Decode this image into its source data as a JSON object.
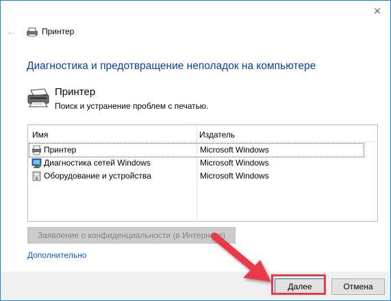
{
  "window": {
    "title": "Принтер",
    "close_glyph": "✕",
    "back_glyph": "←"
  },
  "main": {
    "heading": "Диагностика и предотвращение неполадок на компьютере",
    "program_name": "Принтер",
    "program_description": "Поиск и устранение проблем с печатью."
  },
  "table": {
    "columns": [
      "Имя",
      "Издатель"
    ],
    "rows": [
      {
        "name": "Принтер",
        "publisher": "Microsoft Windows",
        "icon": "printer-icon"
      },
      {
        "name": "Диагностика сетей Windows",
        "publisher": "Microsoft Windows",
        "icon": "network-icon"
      },
      {
        "name": "Оборудование и устройства",
        "publisher": "Microsoft Windows",
        "icon": "device-icon"
      }
    ]
  },
  "buttons": {
    "privacy": "Заявление о конфиденциальности (в Интернете)",
    "advanced": "Дополнительно",
    "next": "Далее",
    "cancel": "Отмена"
  },
  "colors": {
    "accent": "#0078d7",
    "heading": "#0b3f9e",
    "annotation": "#e93b46"
  }
}
